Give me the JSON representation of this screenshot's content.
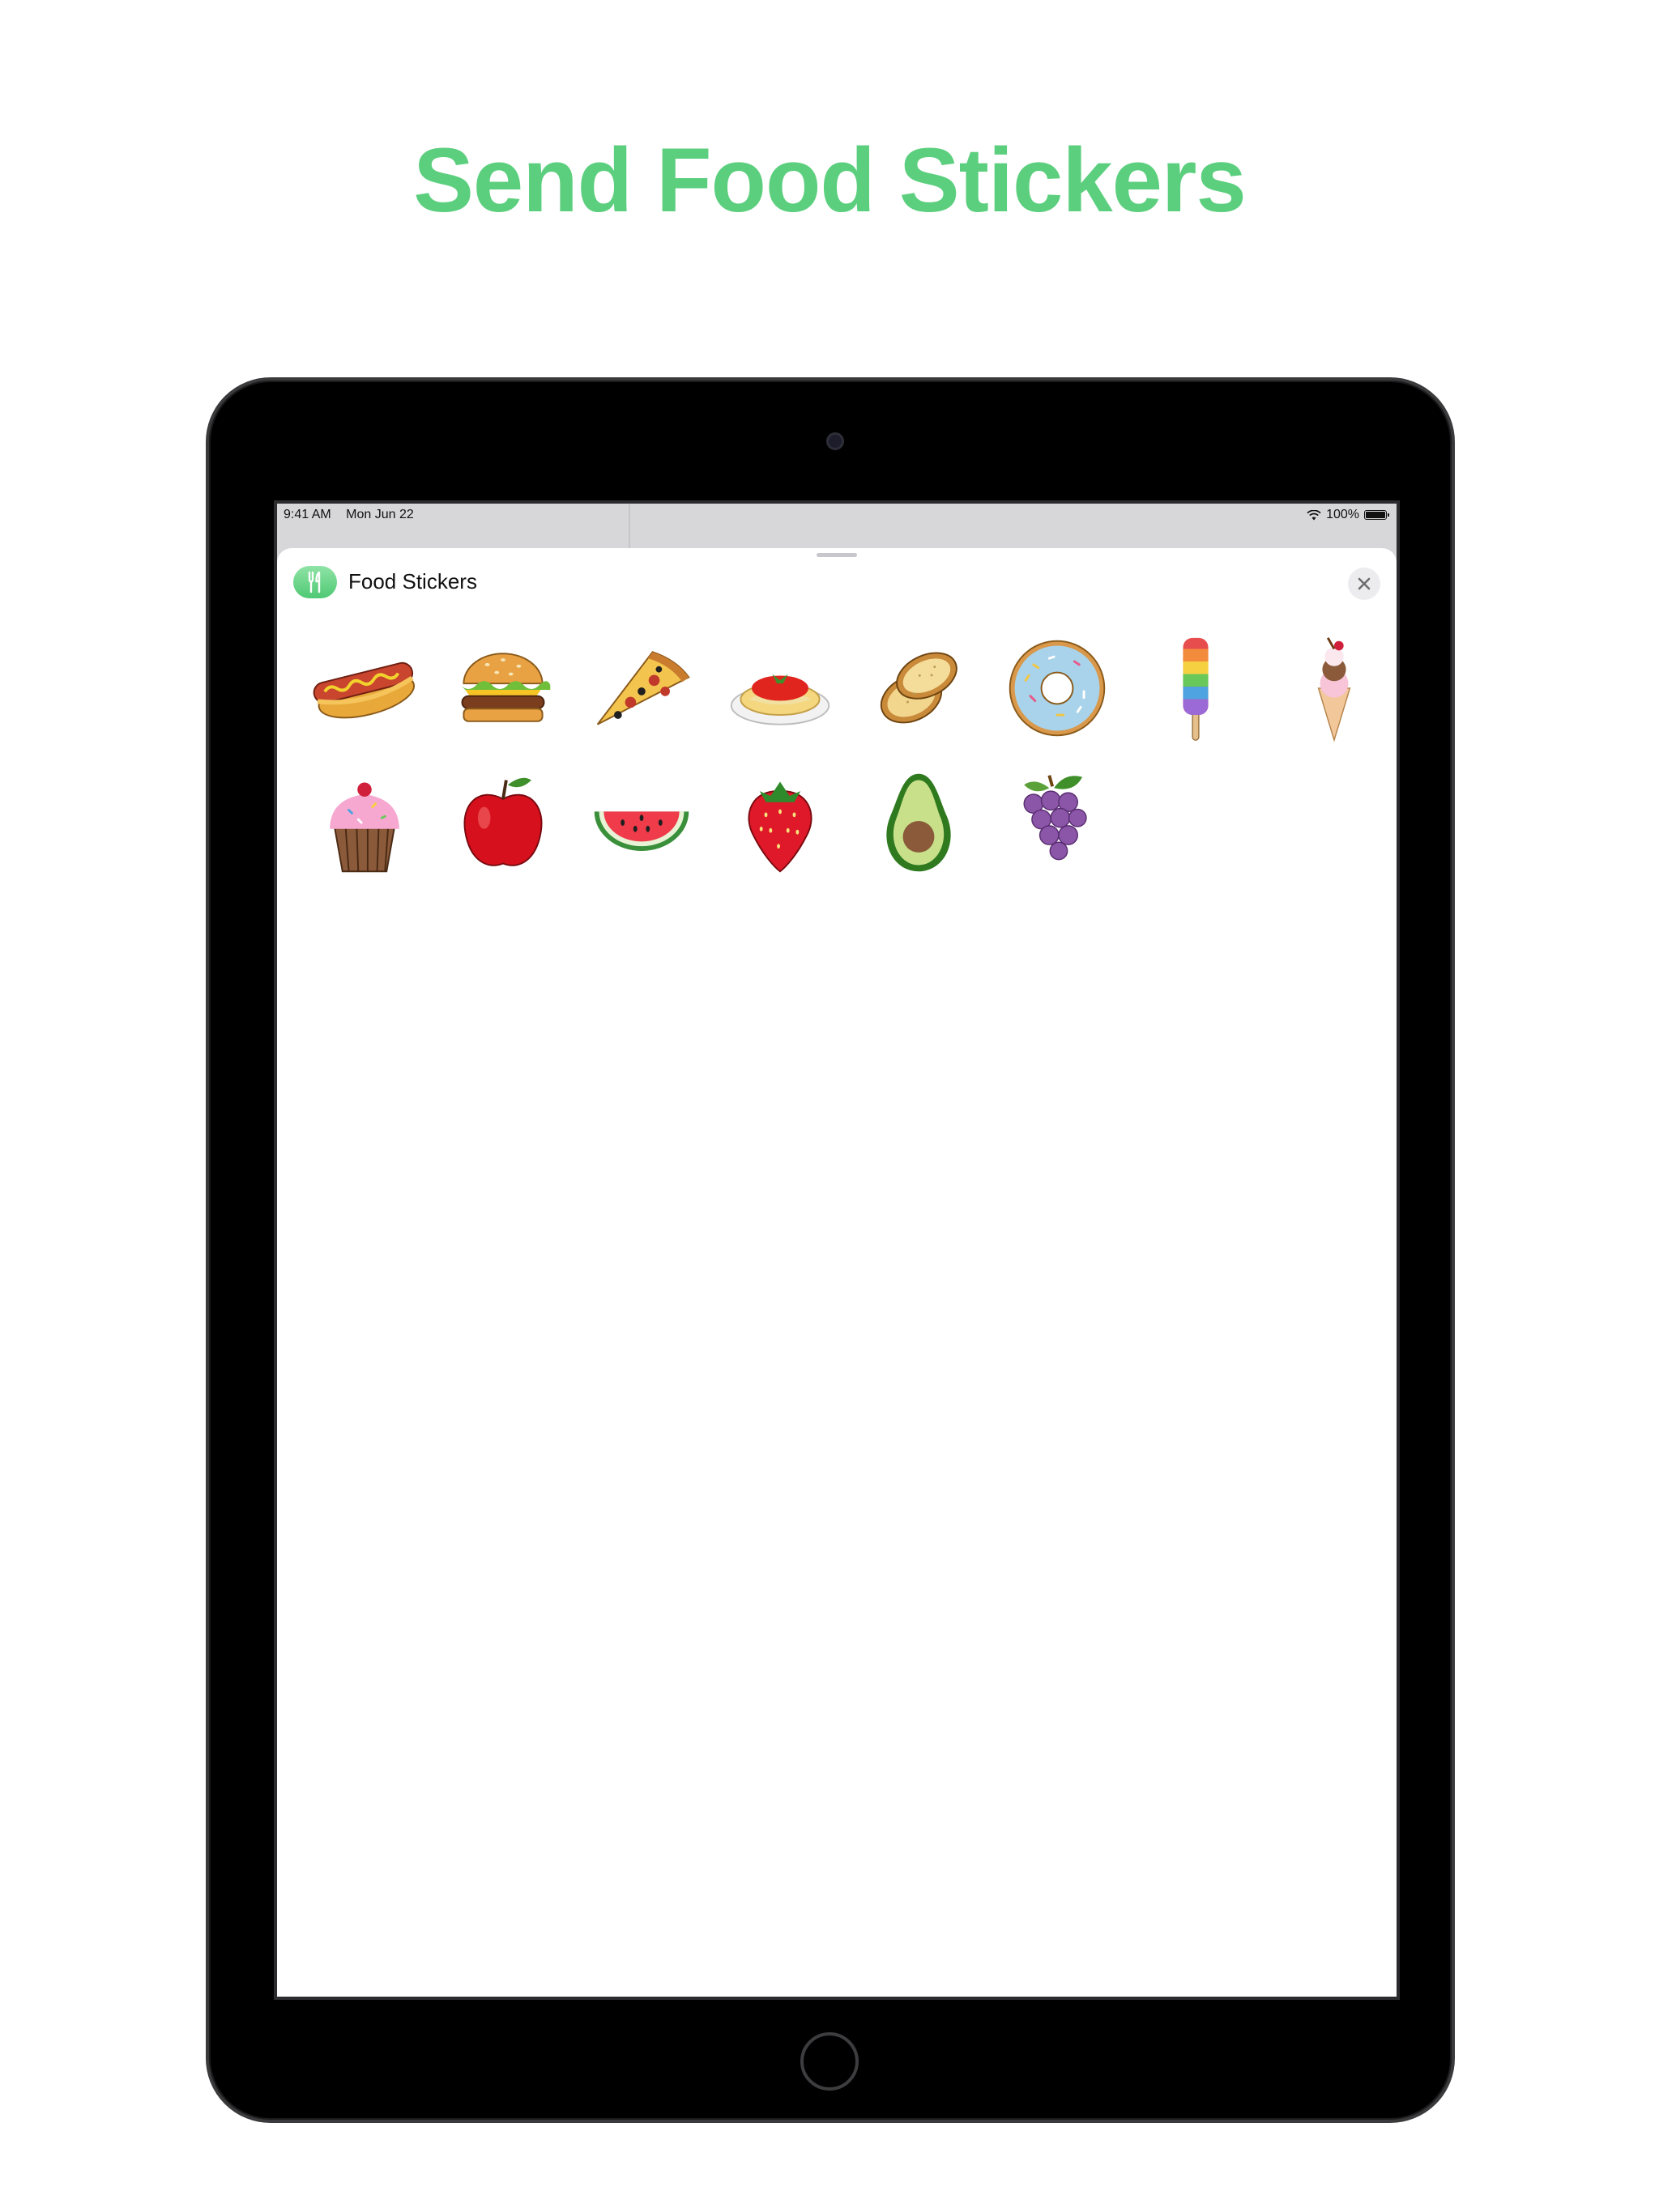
{
  "headline": "Send Food Stickers",
  "status_bar": {
    "time": "9:41 AM",
    "date": "Mon Jun 22",
    "battery": "100%"
  },
  "app": {
    "title": "Food Stickers",
    "icon": "fork-knife-icon",
    "accent_color": "#5ccf7e"
  },
  "stickers": [
    {
      "name": "hot-dog"
    },
    {
      "name": "hamburger"
    },
    {
      "name": "pizza-slice"
    },
    {
      "name": "spaghetti"
    },
    {
      "name": "garlic-bread"
    },
    {
      "name": "donut"
    },
    {
      "name": "rainbow-popsicle"
    },
    {
      "name": "ice-cream-cone"
    },
    {
      "name": "cupcake"
    },
    {
      "name": "apple"
    },
    {
      "name": "watermelon-slice"
    },
    {
      "name": "strawberry"
    },
    {
      "name": "avocado"
    },
    {
      "name": "grapes"
    }
  ]
}
